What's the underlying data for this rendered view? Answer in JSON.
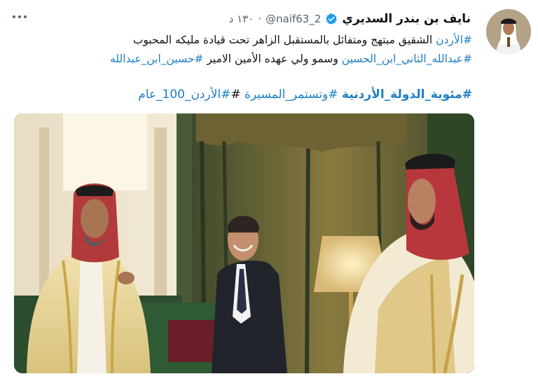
{
  "author": {
    "display_name": "نايف بن بندر السديري",
    "handle": "@naif63_2",
    "timestamp": "١٣٠ د",
    "avatar": "profile-photo",
    "verified_icon": "verified-badge-icon"
  },
  "more_icon": "more-options-icon",
  "tweet": {
    "line1": {
      "hashtag": "#الأردن",
      "text": " الشقيق مبتهج ومتفائل بالمستقبل الزاهر تحت قيادة مليكه المحبوب"
    },
    "line2": {
      "hashtag1": "#عبدالله_الثاني_ابن_الحسين",
      "text": " وسمو ولي عهده الأمين الامير ",
      "hashtag2": "#حسين_ابن_عبدالله"
    },
    "line3": {
      "hashtag1": "#مئوية_الدولة_الأردنية",
      "hashtag2": "#وتستمر_المسيرة",
      "hash_mark": "#",
      "hashtag3": "#الأردن_100_عام"
    }
  },
  "media": {
    "type": "photo",
    "description_icon": "meeting-photo"
  },
  "colors": {
    "link": "#1d7fc4",
    "verified": "#1d9bf0",
    "muted": "#536471"
  }
}
